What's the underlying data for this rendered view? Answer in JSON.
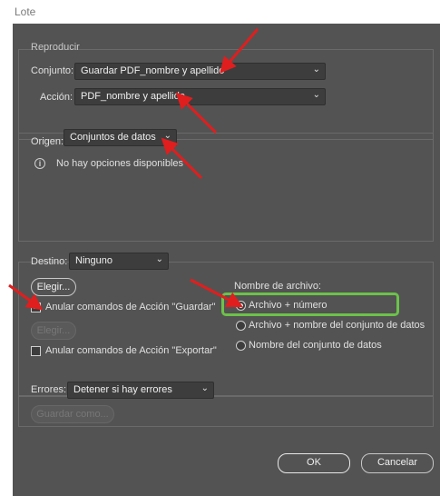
{
  "window": {
    "title": "Lote"
  },
  "reproducir": {
    "legend": "Reproducir",
    "conjunto_label": "Conjunto:",
    "conjunto_value": "Guardar PDF_nombre y apellido",
    "accion_label": "Acción:",
    "accion_value": "PDF_nombre y apellido"
  },
  "origen": {
    "label": "Origen:",
    "value": "Conjuntos de datos",
    "info_text": "No hay opciones disponibles"
  },
  "destino": {
    "label": "Destino:",
    "value": "Ninguno",
    "elegir_label": "Elegir...",
    "anular_guardar_label": "Anular comandos de Acción \"Guardar\"",
    "anular_guardar_checked": true,
    "elegir2_label": "Elegir...",
    "anular_exportar_label": "Anular comandos de Acción \"Exportar\"",
    "anular_exportar_checked": false,
    "nombre_archivo_label": "Nombre de archivo:",
    "options": [
      {
        "label": "Archivo + número",
        "selected": true
      },
      {
        "label": "Archivo + nombre del conjunto de datos",
        "selected": false
      },
      {
        "label": "Nombre del conjunto de datos",
        "selected": false
      }
    ]
  },
  "errores": {
    "label": "Errores:",
    "value": "Detener si hay errores",
    "guardar_como_label": "Guardar como..."
  },
  "footer": {
    "ok_label": "OK",
    "cancel_label": "Cancelar"
  },
  "annotation": {
    "arrow_color": "#e01e1e",
    "highlight_color": "#6cc24a"
  }
}
